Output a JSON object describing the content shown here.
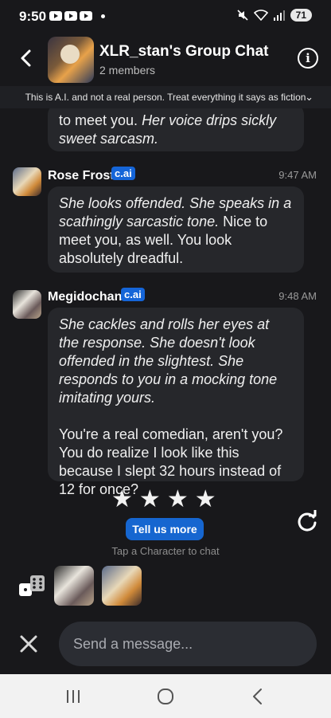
{
  "status": {
    "time": "9:50",
    "battery": "71"
  },
  "header": {
    "title": "XLR_stan's Group Chat",
    "subtitle": "2 members"
  },
  "disclaimer": "This is A.I. and not a real person. Treat everything it says as fiction",
  "messages": [
    {
      "partial": true,
      "parts": [
        {
          "text": "to meet you. "
        },
        {
          "text": "Her voice drips sickly sweet sarcasm.",
          "italic": true
        }
      ]
    },
    {
      "sender": "Rose Frost",
      "badge": "c.ai",
      "time": "9:47 AM",
      "parts": [
        {
          "text": "She looks offended. She speaks in a scathingly sarcastic tone.",
          "italic": true
        },
        {
          "text": " Nice to meet you, as well. You look absolutely dreadful."
        }
      ]
    },
    {
      "sender": "Megidochan",
      "badge": "c.ai",
      "time": "9:48 AM",
      "parts": [
        {
          "text": "She cackles and rolls her eyes at the response. She doesn't look offended in the slightest. She responds to you in a mocking tone imitating yours.",
          "italic": true
        },
        {
          "text": "You're a real comedian, aren't you? You do realize I look like this because I slept 32 hours instead of 12 for once?"
        }
      ]
    }
  ],
  "rating": {
    "stars": 4
  },
  "feedback_button": "Tell us more",
  "tap_hint": "Tap a Character to chat",
  "input": {
    "placeholder": "Send a message..."
  },
  "icons": {
    "back": "arrow-left-icon",
    "info": "info-icon",
    "chevron": "chevron-down-icon",
    "refresh": "refresh-icon",
    "dice": "dice-icon",
    "close": "close-icon",
    "nav_recents": "recents-icon",
    "nav_home": "home-icon",
    "nav_back": "back-icon"
  },
  "colors": {
    "background": "#18181b",
    "bubble": "#26272b",
    "accent": "#1666d0",
    "badge": "#1565d8"
  }
}
